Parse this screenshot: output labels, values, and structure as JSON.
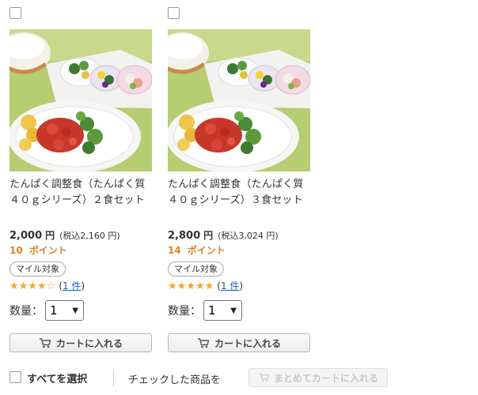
{
  "products": [
    {
      "title": "たんぱく調整食（たんぱく質４０ｇシリーズ）２食セット",
      "price": "2,000",
      "currency": "円",
      "tax_note": "(税込2,160 円)",
      "points_value": "10",
      "points_label": "ポイント",
      "badge": "マイル対象",
      "rating": 4,
      "rating_max": 5,
      "stars_text": "★★★★☆",
      "paren_open": "(",
      "review_link": "1 件",
      "paren_close": ")",
      "qty_label": "数量：",
      "qty_value": "1",
      "cart_button": "カートに入れる",
      "image_icon": "meal-set-photo"
    },
    {
      "title": "たんぱく調整食（たんぱく質４０ｇシリーズ）３食セット",
      "price": "2,800",
      "currency": "円",
      "tax_note": "(税込3,024 円)",
      "points_value": "14",
      "points_label": "ポイント",
      "badge": "マイル対象",
      "rating": 5,
      "rating_max": 5,
      "stars_text": "★★★★★",
      "paren_open": "(",
      "review_link": "1 件",
      "paren_close": ")",
      "qty_label": "数量：",
      "qty_value": "1",
      "cart_button": "カートに入れる",
      "image_icon": "meal-set-photo"
    }
  ],
  "bulk": {
    "select_all_label": "すべてを選択",
    "checked_label": "チェックした商品を",
    "bulk_cart_button": "まとめてカートに入れる"
  },
  "colors": {
    "points": "#d9822b",
    "stars": "#f5a623",
    "link": "#1a5fb4",
    "disabled_text": "#c8c8c8"
  },
  "icons": {
    "cart": "cart-icon",
    "chevron": "chevron-down-icon"
  }
}
